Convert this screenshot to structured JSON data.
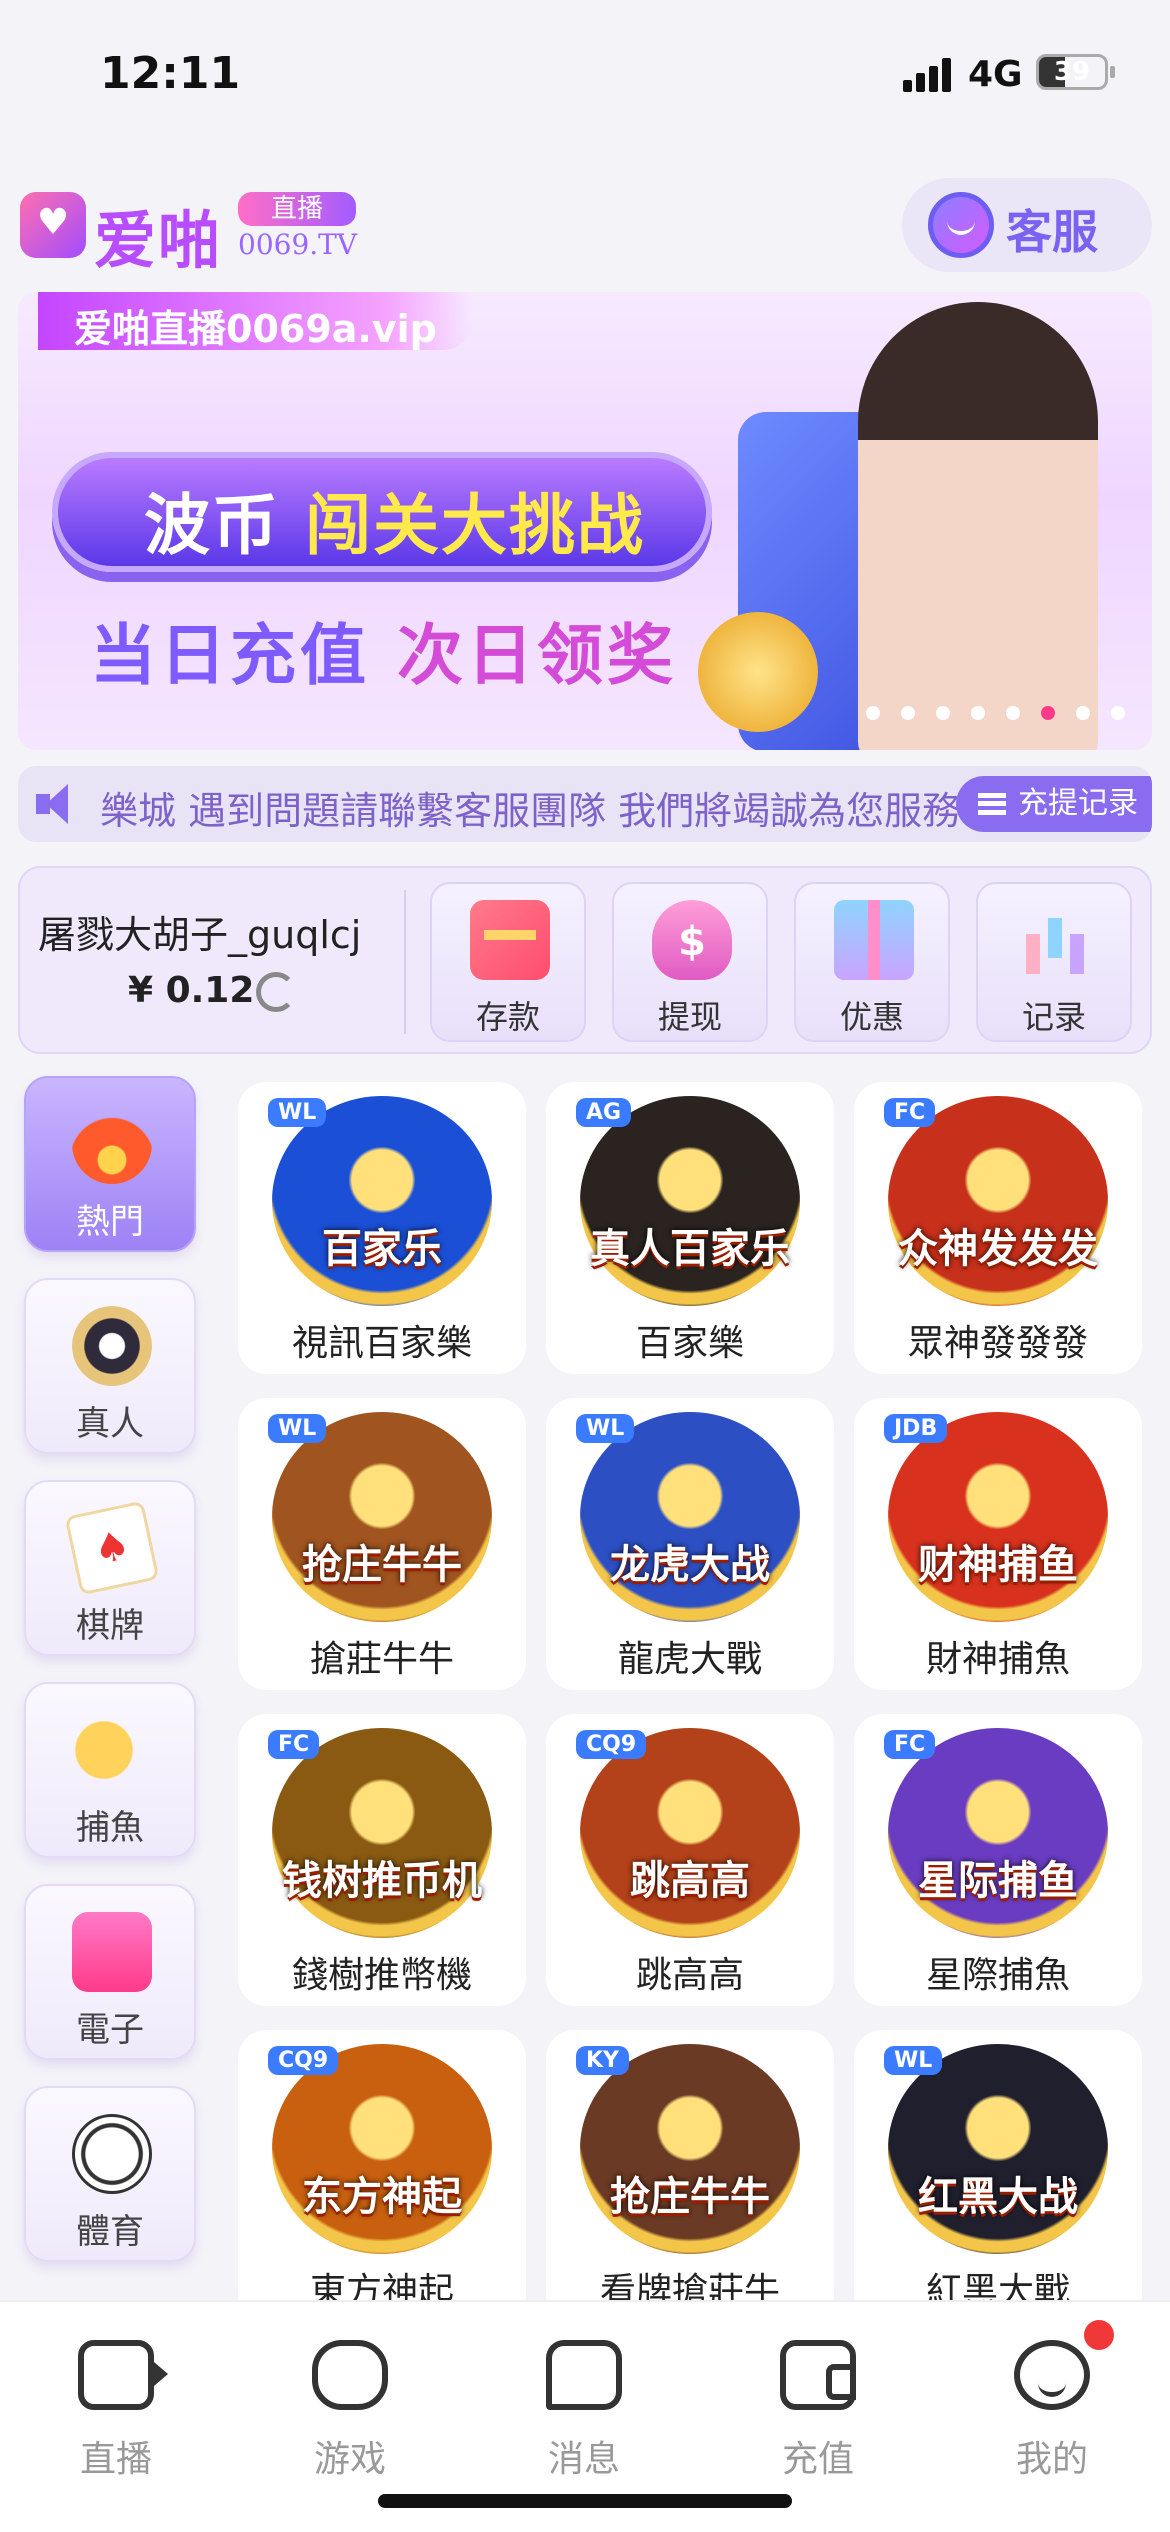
{
  "status_bar": {
    "time": "12:11",
    "network": "4G",
    "battery": "39",
    "battery_level": 0.39
  },
  "header": {
    "logo_brand": "爱啪",
    "logo_tag": "直播",
    "logo_url": "0069.TV",
    "service_label": "客服"
  },
  "banner": {
    "top_tag": "爱啪直播0069a.vip",
    "headline_a": "波币",
    "headline_b": "闯关大挑战",
    "sub_a": "当日充值",
    "sub_b": "次日领奖",
    "slide_count": 8,
    "active_slide": 6
  },
  "marquee": {
    "text": "樂城  遇到問題請聯繫客服團隊 我們將竭誠為您服務",
    "records_label": "充提记录"
  },
  "account": {
    "username": "屠戮大胡子_guqlcj",
    "balance": "¥ 0.12",
    "actions": [
      {
        "label": "存款",
        "icon": "card-icon"
      },
      {
        "label": "提现",
        "icon": "money-bag-icon"
      },
      {
        "label": "优惠",
        "icon": "gift-icon"
      },
      {
        "label": "记录",
        "icon": "bar-chart-icon"
      }
    ]
  },
  "categories": [
    {
      "label": "熱門",
      "icon": "fire-icon",
      "active": true
    },
    {
      "label": "真人",
      "icon": "chip-icon"
    },
    {
      "label": "棋牌",
      "icon": "poker-icon"
    },
    {
      "label": "捕魚",
      "icon": "fish-icon"
    },
    {
      "label": "電子",
      "icon": "slot-icon"
    },
    {
      "label": "體育",
      "icon": "soccer-icon"
    }
  ],
  "games": [
    {
      "label": "視訊百家樂",
      "art": "百家乐",
      "provider": "WL",
      "color": "#1a4fd6"
    },
    {
      "label": "百家樂",
      "art": "真人百家乐",
      "provider": "AG",
      "color": "#2a2320"
    },
    {
      "label": "眾神發發發",
      "art": "众神发发发",
      "provider": "FC",
      "color": "#c7301a"
    },
    {
      "label": "搶莊牛牛",
      "art": "抢庄牛牛",
      "provider": "WL",
      "color": "#a0541f"
    },
    {
      "label": "龍虎大戰",
      "art": "龙虎大战",
      "provider": "WL",
      "color": "#2c4fc4"
    },
    {
      "label": "財神捕魚",
      "art": "财神捕鱼",
      "provider": "JDB",
      "color": "#d8321e"
    },
    {
      "label": "錢樹推幣機",
      "art": "钱树推币机",
      "provider": "FC",
      "color": "#8a5a12"
    },
    {
      "label": "跳高高",
      "art": "跳高高",
      "provider": "CQ9",
      "color": "#b3421a"
    },
    {
      "label": "星際捕魚",
      "art": "星际捕鱼",
      "provider": "FC",
      "color": "#6a3cc2"
    },
    {
      "label": "東方神起",
      "art": "东方神起",
      "provider": "CQ9",
      "color": "#c8600f"
    },
    {
      "label": "看牌搶莊牛",
      "art": "抢庄牛牛",
      "provider": "KY",
      "color": "#6b3a24"
    },
    {
      "label": "紅黑大戰",
      "art": "红黑大战",
      "provider": "WL",
      "color": "#1f1f2e"
    }
  ],
  "tabs": [
    {
      "label": "直播",
      "icon": "camera-icon"
    },
    {
      "label": "游戏",
      "icon": "gamepad-icon"
    },
    {
      "label": "消息",
      "icon": "message-icon"
    },
    {
      "label": "充值",
      "icon": "wallet-icon"
    },
    {
      "label": "我的",
      "icon": "profile-icon",
      "badge": true
    }
  ]
}
